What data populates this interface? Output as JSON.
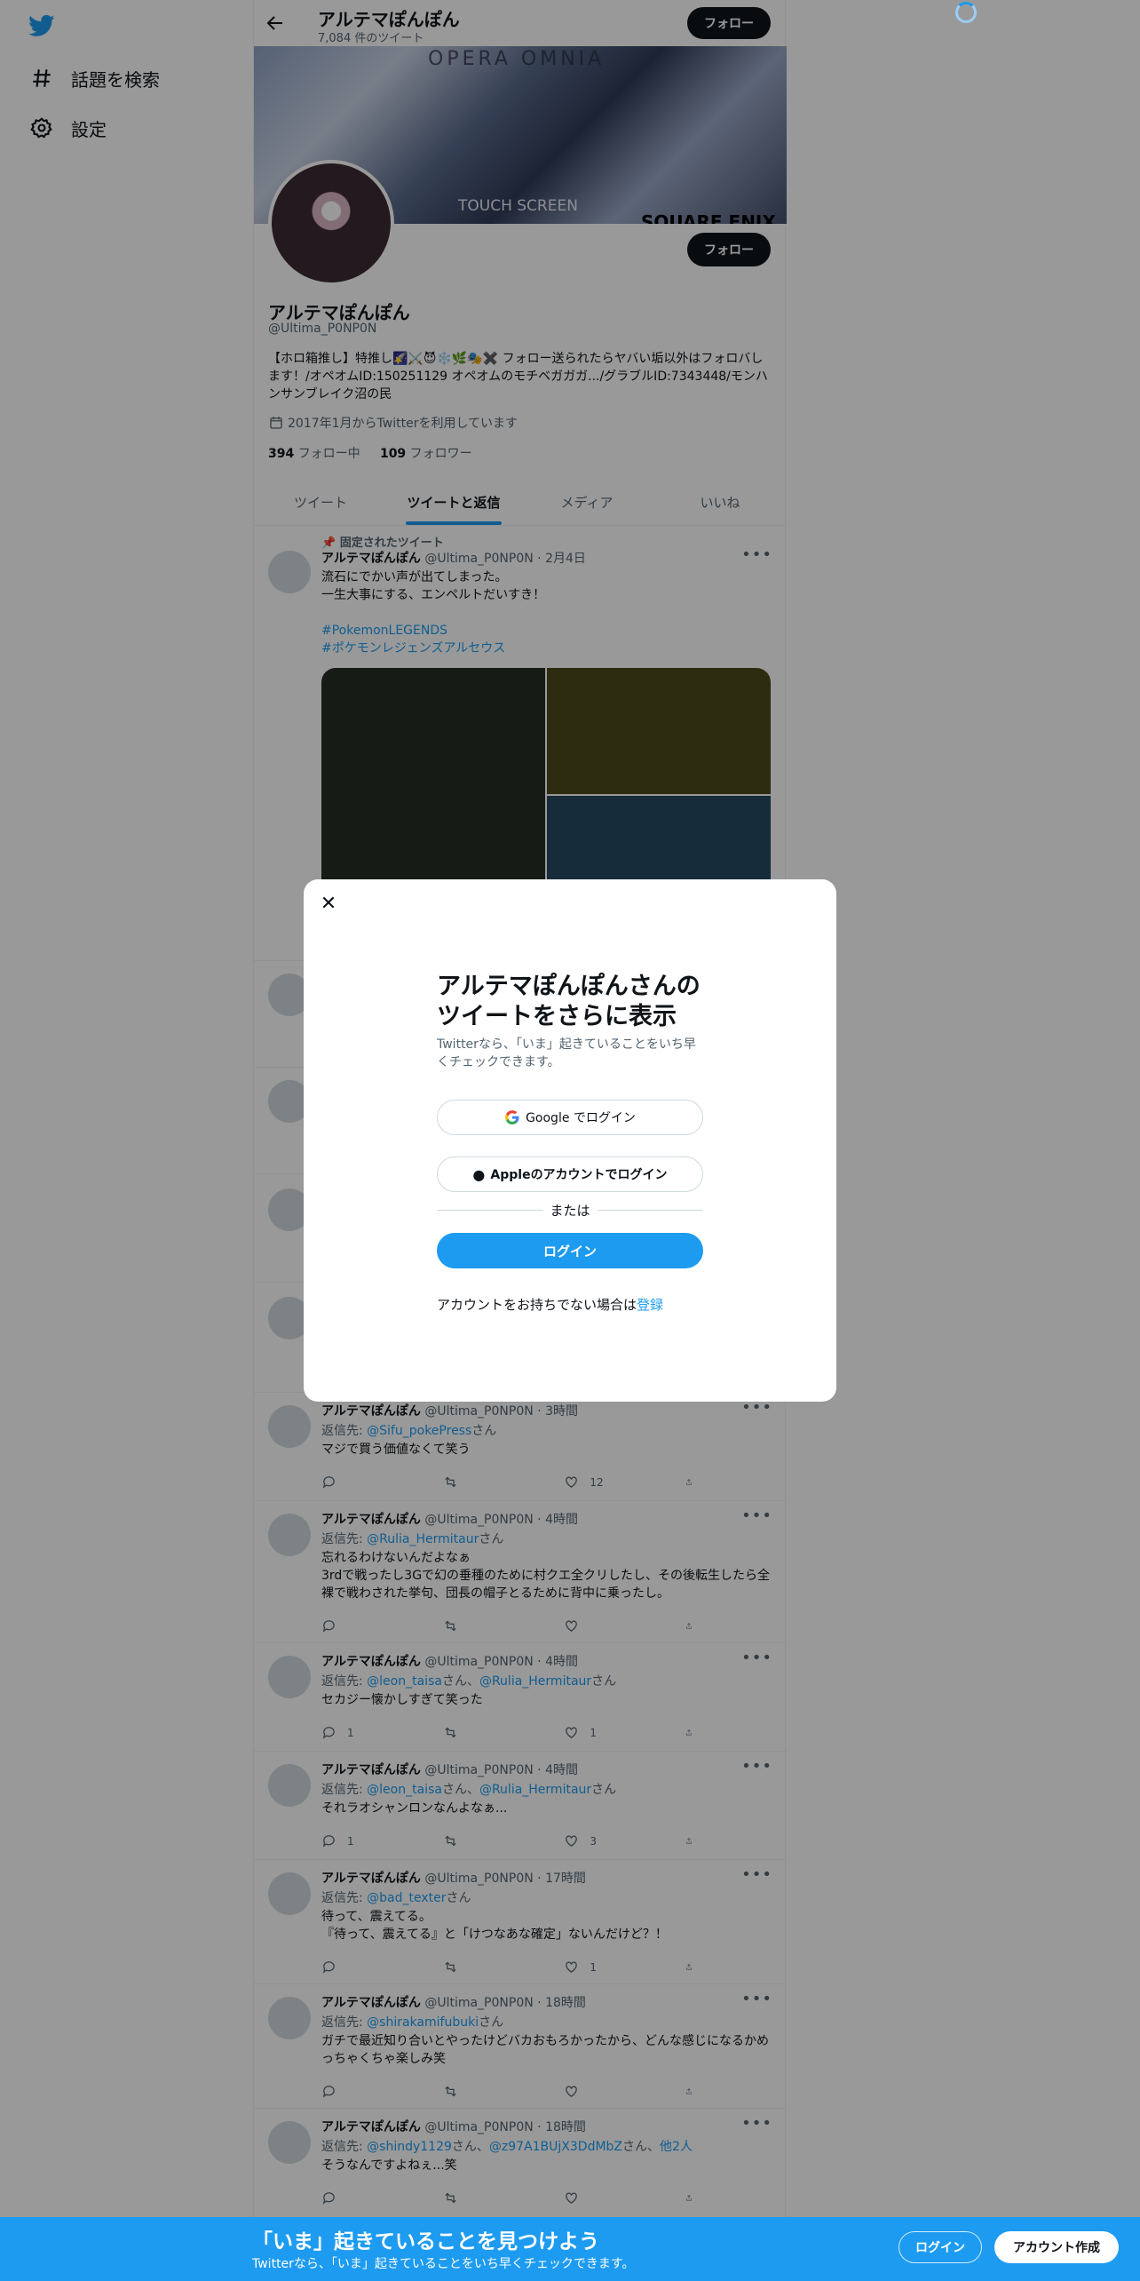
{
  "colors": {
    "accent": "#1d9bf0",
    "text": "#0f1419",
    "muted": "#536471"
  },
  "sidebar": {
    "items": [
      {
        "icon": "hashtag-icon",
        "label": "話題を検索"
      },
      {
        "icon": "gear-icon",
        "label": "設定"
      }
    ]
  },
  "header": {
    "title": "アルテマぽんぽん",
    "tweet_count": "7,084 件のツイート",
    "follow_label": "フォロー"
  },
  "banner": {
    "line1": "OPERA OMNIA",
    "line2": "TOUCH SCREEN",
    "line3": "SQUARE ENIX"
  },
  "profile": {
    "name": "アルテマぽんぽん",
    "handle": "@Ultima_P0NP0N",
    "bio": "【ホロ箱推し】特推し🌠⚔️😈❄️🌿🎭✖️ フォロー送られたらヤバい垢以外はフォロバします！/オペオムID:150251129 オペオムのモチベガガガ.../グラブルID:7343448/モンハンサンブレイク沼の民",
    "joined": "2017年1月からTwitterを利用しています",
    "following_count": "394",
    "following_label": "フォロー中",
    "followers_count": "109",
    "followers_label": "フォロワー",
    "follow_label": "フォロー"
  },
  "tabs": [
    {
      "label": "ツイート"
    },
    {
      "label": "ツイートと返信",
      "active": true
    },
    {
      "label": "メディア"
    },
    {
      "label": "いいね"
    }
  ],
  "pinned_tweet": {
    "pinned_label": "固定されたツイート",
    "name": "アルテマぽんぽん",
    "handle": "@Ultima_P0NP0N",
    "time": "2月4日",
    "text": "流石にでかい声が出てしまった。\n一生大事にする、エンペルトだいすき！",
    "hashtags": [
      "#PokemonLEGENDS",
      "#ポケモンレジェンズアルセウス"
    ],
    "media_colors": [
      "#252e25",
      "#4e4a1c",
      "#254a61"
    ]
  },
  "tweets": [
    {
      "name": "アルテマぽんぽん",
      "handle": "@Ultima_P0NP0N",
      "time": "3時間",
      "reply_prefix": "返信先: ",
      "reply_to": "@Sifu_pokePress",
      "reply_suffix": "さん",
      "text": "マジで買う価値なくて笑う",
      "replies": "",
      "retweets": "",
      "likes": "12"
    },
    {
      "name": "アルテマぽんぽん",
      "handle": "@Ultima_P0NP0N",
      "time": "4時間",
      "reply_prefix": "返信先: ",
      "reply_to": "@Rulia_Hermitaur",
      "reply_suffix": "さん",
      "text": "忘れるわけないんだよなぁ\n3rdで戦ったし3Gで幻の垂種のために村クエ全クリしたし、その後転生したら全裸で戦わされた挙句、団長の帽子とるために背中に乗ったし。",
      "replies": "",
      "retweets": "",
      "likes": ""
    },
    {
      "name": "アルテマぽんぽん",
      "handle": "@Ultima_P0NP0N",
      "time": "4時間",
      "reply_prefix": "返信先: ",
      "reply_to": "@leon_taisa",
      "reply_mid": "さん、",
      "reply_to2": "@Rulia_Hermitaur",
      "reply_suffix": "さん",
      "text": "セカジー懐かしすぎて笑った",
      "replies": "1",
      "retweets": "",
      "likes": "1"
    },
    {
      "name": "アルテマぽんぽん",
      "handle": "@Ultima_P0NP0N",
      "time": "4時間",
      "reply_prefix": "返信先: ",
      "reply_to": "@leon_taisa",
      "reply_mid": "さん、",
      "reply_to2": "@Rulia_Hermitaur",
      "reply_suffix": "さん",
      "text": "それラオシャンロンなんよなぁ...",
      "replies": "1",
      "retweets": "",
      "likes": "3"
    },
    {
      "name": "アルテマぽんぽん",
      "handle": "@Ultima_P0NP0N",
      "time": "17時間",
      "reply_prefix": "返信先: ",
      "reply_to": "@bad_texter",
      "reply_suffix": "さん",
      "text": "待って、震えてる。\n『待って、震えてる』と「けつなあな確定」ないんだけど？！",
      "replies": "",
      "retweets": "",
      "likes": "1"
    },
    {
      "name": "アルテマぽんぽん",
      "handle": "@Ultima_P0NP0N",
      "time": "18時間",
      "reply_prefix": "返信先: ",
      "reply_to": "@shirakamifubuki",
      "reply_suffix": "さん",
      "text": "ガチで最近知り合いとやったけどバカおもろかったから、どんな感じになるかめっちゃくちゃ楽しみ笑",
      "replies": "",
      "retweets": "",
      "likes": ""
    },
    {
      "name": "アルテマぽんぽん",
      "handle": "@Ultima_P0NP0N",
      "time": "18時間",
      "reply_prefix": "返信先: ",
      "reply_to": "@shindy1129",
      "reply_mid": "さん、",
      "reply_to2": "@z97A1BUjX3DdMbZ",
      "reply_mid2": "さん、",
      "reply_to3": "他2人",
      "reply_suffix": "",
      "text": "そうなんですよねぇ...笑",
      "replies": "",
      "retweets": "",
      "likes": ""
    }
  ],
  "modal": {
    "title": "アルテマぽんぽんさんのツイートをさらに表示",
    "subtitle": "Twitterなら、「いま」起きていることをいち早くチェックできます。",
    "google_label": "Google でログイン",
    "apple_label": "Appleのアカウントでログイン",
    "or_label": "または",
    "login_label": "ログイン",
    "signup_text": "アカウントをお持ちでない場合は",
    "signup_link": "登録"
  },
  "bottom_bar": {
    "title": "「いま」起きていることを見つけよう",
    "subtitle": "Twitterなら、「いま」起きていることをいち早くチェックできます。",
    "login_label": "ログイン",
    "signup_label": "アカウント作成"
  }
}
